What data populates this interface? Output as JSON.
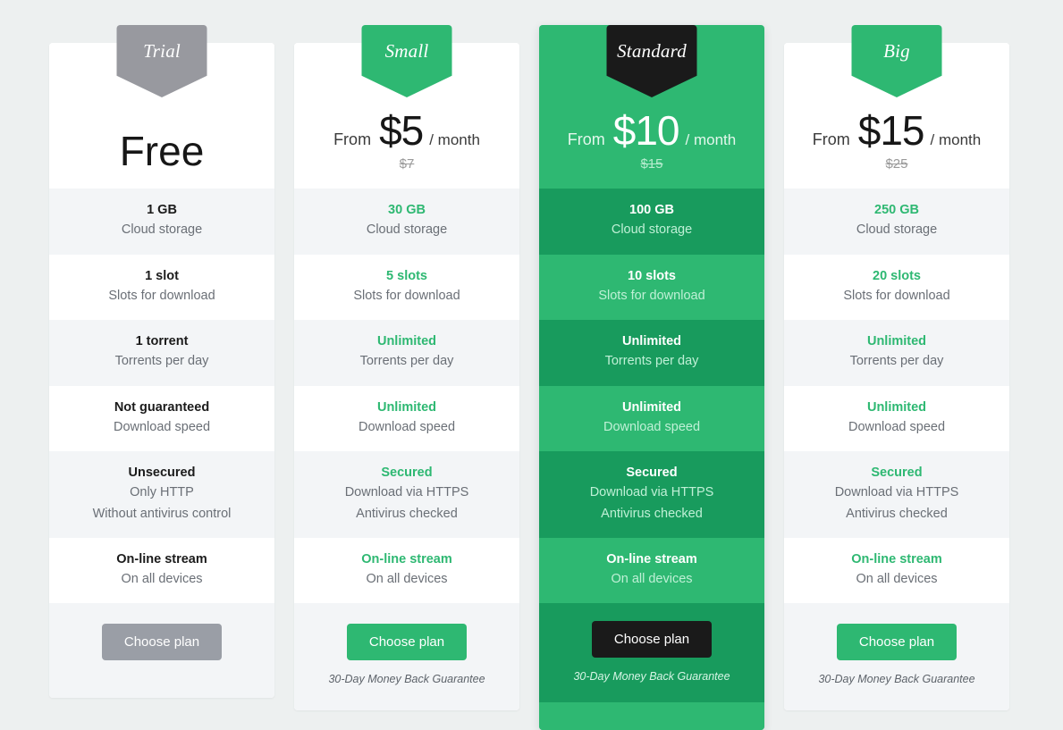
{
  "theme": {
    "page_background": "#edf0f0",
    "accent_green": "#2eb872",
    "accent_green_dark": "#189b5d",
    "trial_gray": "#98999f",
    "featured_ribbon_black": "#1a1a1a"
  },
  "feature_labels": [
    "Cloud storage",
    "Slots for download",
    "Torrents per day",
    "Download speed",
    "Secured",
    "On-line stream"
  ],
  "plans": [
    {
      "id": "trial",
      "ribbon": "Trial",
      "ribbon_color": "#98999f",
      "price_from": "",
      "price_amount": "Free",
      "price_period": "",
      "price_old": "",
      "is_free": true,
      "features": [
        {
          "title": "1 GB",
          "subs": [
            "Cloud storage"
          ],
          "accent": false
        },
        {
          "title": "1 slot",
          "subs": [
            "Slots for download"
          ],
          "accent": false
        },
        {
          "title": "1 torrent",
          "subs": [
            "Torrents per day"
          ],
          "accent": false
        },
        {
          "title": "Not guaranteed",
          "subs": [
            "Download speed"
          ],
          "accent": false
        },
        {
          "title": "Unsecured",
          "subs": [
            "Only HTTP",
            "Without antivirus control"
          ],
          "accent": false
        },
        {
          "title": "On-line stream",
          "subs": [
            "On all devices"
          ],
          "accent": false
        }
      ],
      "button_label": "Choose plan",
      "button_color": "#9a9ea6",
      "guarantee": "",
      "has_guarantee": false
    },
    {
      "id": "small",
      "ribbon": "Small",
      "ribbon_color": "#2eb872",
      "price_from": "From",
      "price_amount": "$5",
      "price_period": "/ month",
      "price_old": "$7",
      "is_free": false,
      "features": [
        {
          "title": "30 GB",
          "subs": [
            "Cloud storage"
          ],
          "accent": true
        },
        {
          "title": "5 slots",
          "subs": [
            "Slots for download"
          ],
          "accent": true
        },
        {
          "title": "Unlimited",
          "subs": [
            "Torrents per day"
          ],
          "accent": true
        },
        {
          "title": "Unlimited",
          "subs": [
            "Download speed"
          ],
          "accent": true
        },
        {
          "title": "Secured",
          "subs": [
            "Download via HTTPS",
            "Antivirus checked"
          ],
          "accent": true
        },
        {
          "title": "On-line stream",
          "subs": [
            "On all devices"
          ],
          "accent": true
        }
      ],
      "button_label": "Choose plan",
      "button_color": "#2eb872",
      "guarantee": "30-Day Money Back Guarantee",
      "has_guarantee": true
    },
    {
      "id": "standard",
      "ribbon": "Standard",
      "ribbon_color": "#1a1a1a",
      "featured": true,
      "price_from": "From",
      "price_amount": "$10",
      "price_period": "/ month",
      "price_old": "$15",
      "is_free": false,
      "features": [
        {
          "title": "100 GB",
          "subs": [
            "Cloud storage"
          ],
          "accent": true
        },
        {
          "title": "10 slots",
          "subs": [
            "Slots for download"
          ],
          "accent": true
        },
        {
          "title": "Unlimited",
          "subs": [
            "Torrents per day"
          ],
          "accent": true
        },
        {
          "title": "Unlimited",
          "subs": [
            "Download speed"
          ],
          "accent": true
        },
        {
          "title": "Secured",
          "subs": [
            "Download via HTTPS",
            "Antivirus checked"
          ],
          "accent": true
        },
        {
          "title": "On-line stream",
          "subs": [
            "On all devices"
          ],
          "accent": true
        }
      ],
      "button_label": "Choose plan",
      "button_color": "#1a1a1a",
      "guarantee": "30-Day Money Back Guarantee",
      "has_guarantee": true
    },
    {
      "id": "big",
      "ribbon": "Big",
      "ribbon_color": "#2eb872",
      "price_from": "From",
      "price_amount": "$15",
      "price_period": "/ month",
      "price_old": "$25",
      "is_free": false,
      "features": [
        {
          "title": "250 GB",
          "subs": [
            "Cloud storage"
          ],
          "accent": true
        },
        {
          "title": "20 slots",
          "subs": [
            "Slots for download"
          ],
          "accent": true
        },
        {
          "title": "Unlimited",
          "subs": [
            "Torrents per day"
          ],
          "accent": true
        },
        {
          "title": "Unlimited",
          "subs": [
            "Download speed"
          ],
          "accent": true
        },
        {
          "title": "Secured",
          "subs": [
            "Download via HTTPS",
            "Antivirus checked"
          ],
          "accent": true
        },
        {
          "title": "On-line stream",
          "subs": [
            "On all devices"
          ],
          "accent": true
        }
      ],
      "button_label": "Choose plan",
      "button_color": "#2eb872",
      "guarantee": "30-Day Money Back Guarantee",
      "has_guarantee": true
    }
  ]
}
